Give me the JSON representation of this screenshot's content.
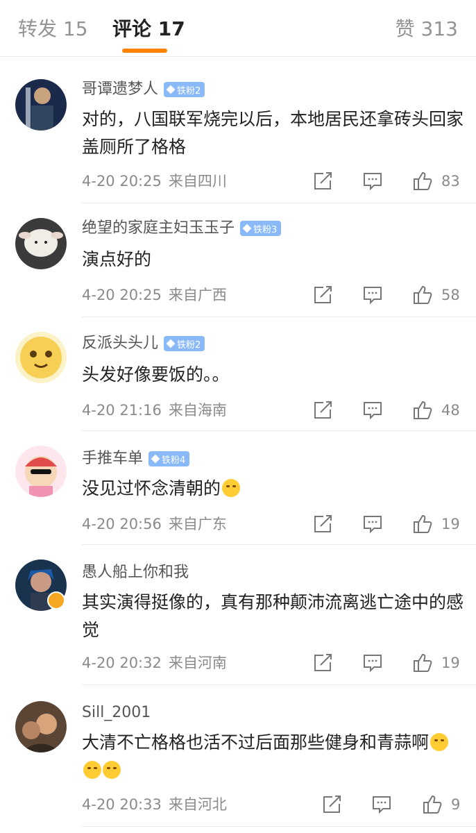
{
  "tabs": {
    "repost": "转发 15",
    "comments": "评论 17",
    "likes": "赞 313"
  },
  "colors": {
    "accent": "#ff8200",
    "badge": "#8ab9f7",
    "verified": "#f5a623"
  },
  "comments": [
    {
      "user": "哥谭遗梦人",
      "badge": "铁粉2",
      "text": "对的，八国联军烧完以后，本地居民还拿砖头回家盖厕所了格格",
      "emoji": "",
      "time": "4-20 20:25",
      "location": "来自四川",
      "likes": "83",
      "verified": false
    },
    {
      "user": "绝望的家庭主妇玉玉子",
      "badge": "铁粉3",
      "text": "演点好的",
      "emoji": "",
      "time": "4-20 20:25",
      "location": "来自广西",
      "likes": "58",
      "verified": false
    },
    {
      "user": "反派头头儿",
      "badge": "铁粉2",
      "text": "头发好像要饭的。。",
      "emoji": "",
      "time": "4-20 21:16",
      "location": "来自海南",
      "likes": "48",
      "verified": false
    },
    {
      "user": "手推车单",
      "badge": "铁粉4",
      "text": "没见过怀念清朝的",
      "emoji": "thinking-face",
      "time": "4-20 20:56",
      "location": "来自广东",
      "likes": "19",
      "verified": false
    },
    {
      "user": "愚人船上你和我",
      "badge": "",
      "text": "其实演得挺像的，真有那种颠沛流离逃亡途中的感觉",
      "emoji": "",
      "time": "4-20 20:32",
      "location": "来自河南",
      "likes": "19",
      "verified": true
    },
    {
      "user": "Sill_2001",
      "badge": "",
      "text": "大清不亡格格也活不过后面那些健身和青蒜啊",
      "emoji": "laughing-crying-face-x3",
      "time": "4-20 20:33",
      "location": "来自河北",
      "likes": "9",
      "verified": false
    }
  ]
}
